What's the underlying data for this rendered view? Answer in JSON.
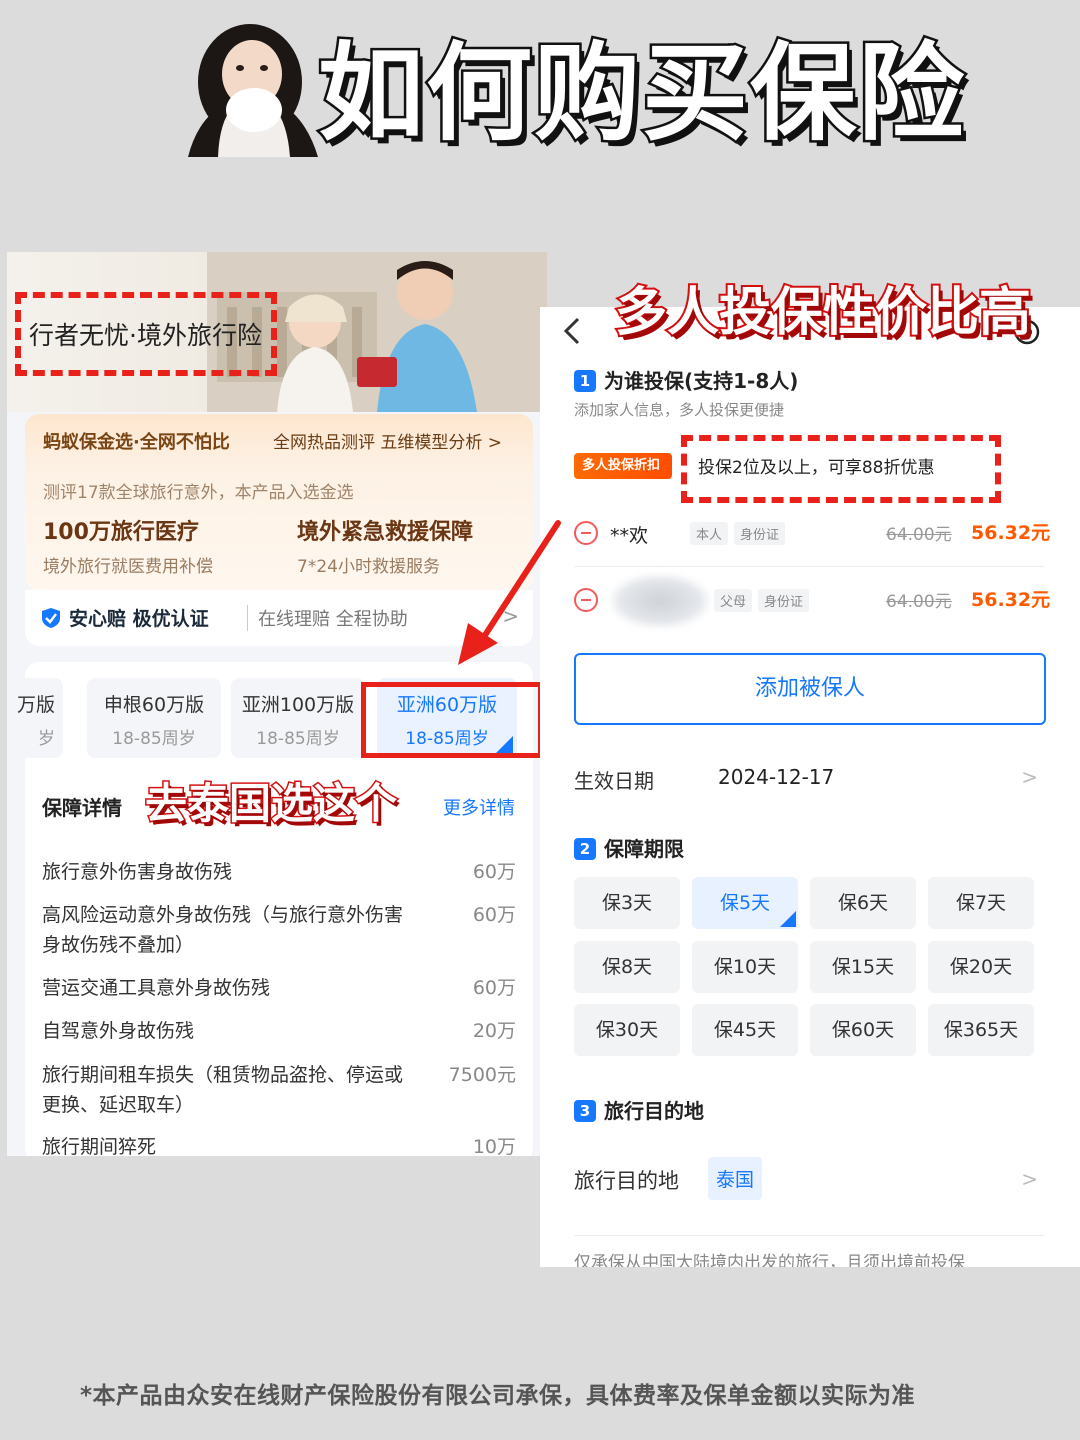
{
  "header": {
    "title": "如何购买保险"
  },
  "left": {
    "brand": "行者无忧·境外旅行险",
    "gold": {
      "title": "蚂蚁保金选·全网不怕比",
      "right": "全网热品测评 五维模型分析 >",
      "sub": "测评17款全球旅行意外，本产品入选金选",
      "f1_t": "100万旅行医疗",
      "f1_d": "境外旅行就医费用补偿",
      "f2_t": "境外紧急救援保障",
      "f2_d": "7*24小时救援服务"
    },
    "anxin": {
      "title": "安心赔 极优认证",
      "desc": "在线理赔 全程协助",
      "chev": ">"
    },
    "plans": [
      {
        "name": "万版",
        "age": "岁"
      },
      {
        "name": "申根60万版",
        "age": "18-85周岁"
      },
      {
        "name": "亚洲100万版",
        "age": "18-85周岁"
      },
      {
        "name": "亚洲60万版",
        "age": "18-85周岁"
      }
    ],
    "thai_label": "去泰国选这个",
    "detail_title": "保障详情",
    "detail_more": "更多详情",
    "coverage": [
      {
        "name": "旅行意外伤害身故伤残",
        "value": "60万"
      },
      {
        "name": "高风险运动意外身故伤残（与旅行意外伤害身故伤残不叠加）",
        "value": "60万"
      },
      {
        "name": "营运交通工具意外身故伤残",
        "value": "60万"
      },
      {
        "name": "自驾意外身故伤残",
        "value": "20万"
      },
      {
        "name": "旅行期间租车损失（租赁物品盗抢、停运或更换、延迟取车）",
        "value": "7500元"
      },
      {
        "name": "旅行期间猝死",
        "value": "10万"
      }
    ]
  },
  "right": {
    "banner": "多人投保性价比高",
    "back": "<",
    "sec1": {
      "num": "1",
      "title": "为谁投保(支持1-8人)",
      "sub": "添加家人信息，多人投保更便捷"
    },
    "discount": {
      "tag": "多人投保折扣",
      "text": "投保2位及以上，可享88折优惠"
    },
    "persons": [
      {
        "name": "**欢",
        "rel": "本人",
        "id": "身份证",
        "old": "64.00元",
        "new": "56.32元"
      },
      {
        "name": "",
        "rel": "父母",
        "id": "身份证",
        "old": "64.00元",
        "new": "56.32元"
      }
    ],
    "add_btn": "添加被保人",
    "date": {
      "label": "生效日期",
      "value": "2024-12-17",
      "chev": ">"
    },
    "sec2": {
      "num": "2",
      "title": "保障期限"
    },
    "durations": [
      "保3天",
      "保5天",
      "保6天",
      "保7天",
      "保8天",
      "保10天",
      "保15天",
      "保20天",
      "保30天",
      "保45天",
      "保60天",
      "保365天"
    ],
    "sec3": {
      "num": "3",
      "title": "旅行目的地"
    },
    "dest": {
      "label": "旅行目的地",
      "value": "泰国",
      "chev": ">"
    },
    "note": "仅承保从中国大陆境内出发的旅行，且须出境前投保"
  },
  "footer": "*本产品由众安在线财产保险股份有限公司承保，具体费率及保单金额以实际为准",
  "colors": {
    "brand_blue": "#1677ff",
    "highlight_red": "#e8221a",
    "price_orange": "#ff5a00"
  }
}
